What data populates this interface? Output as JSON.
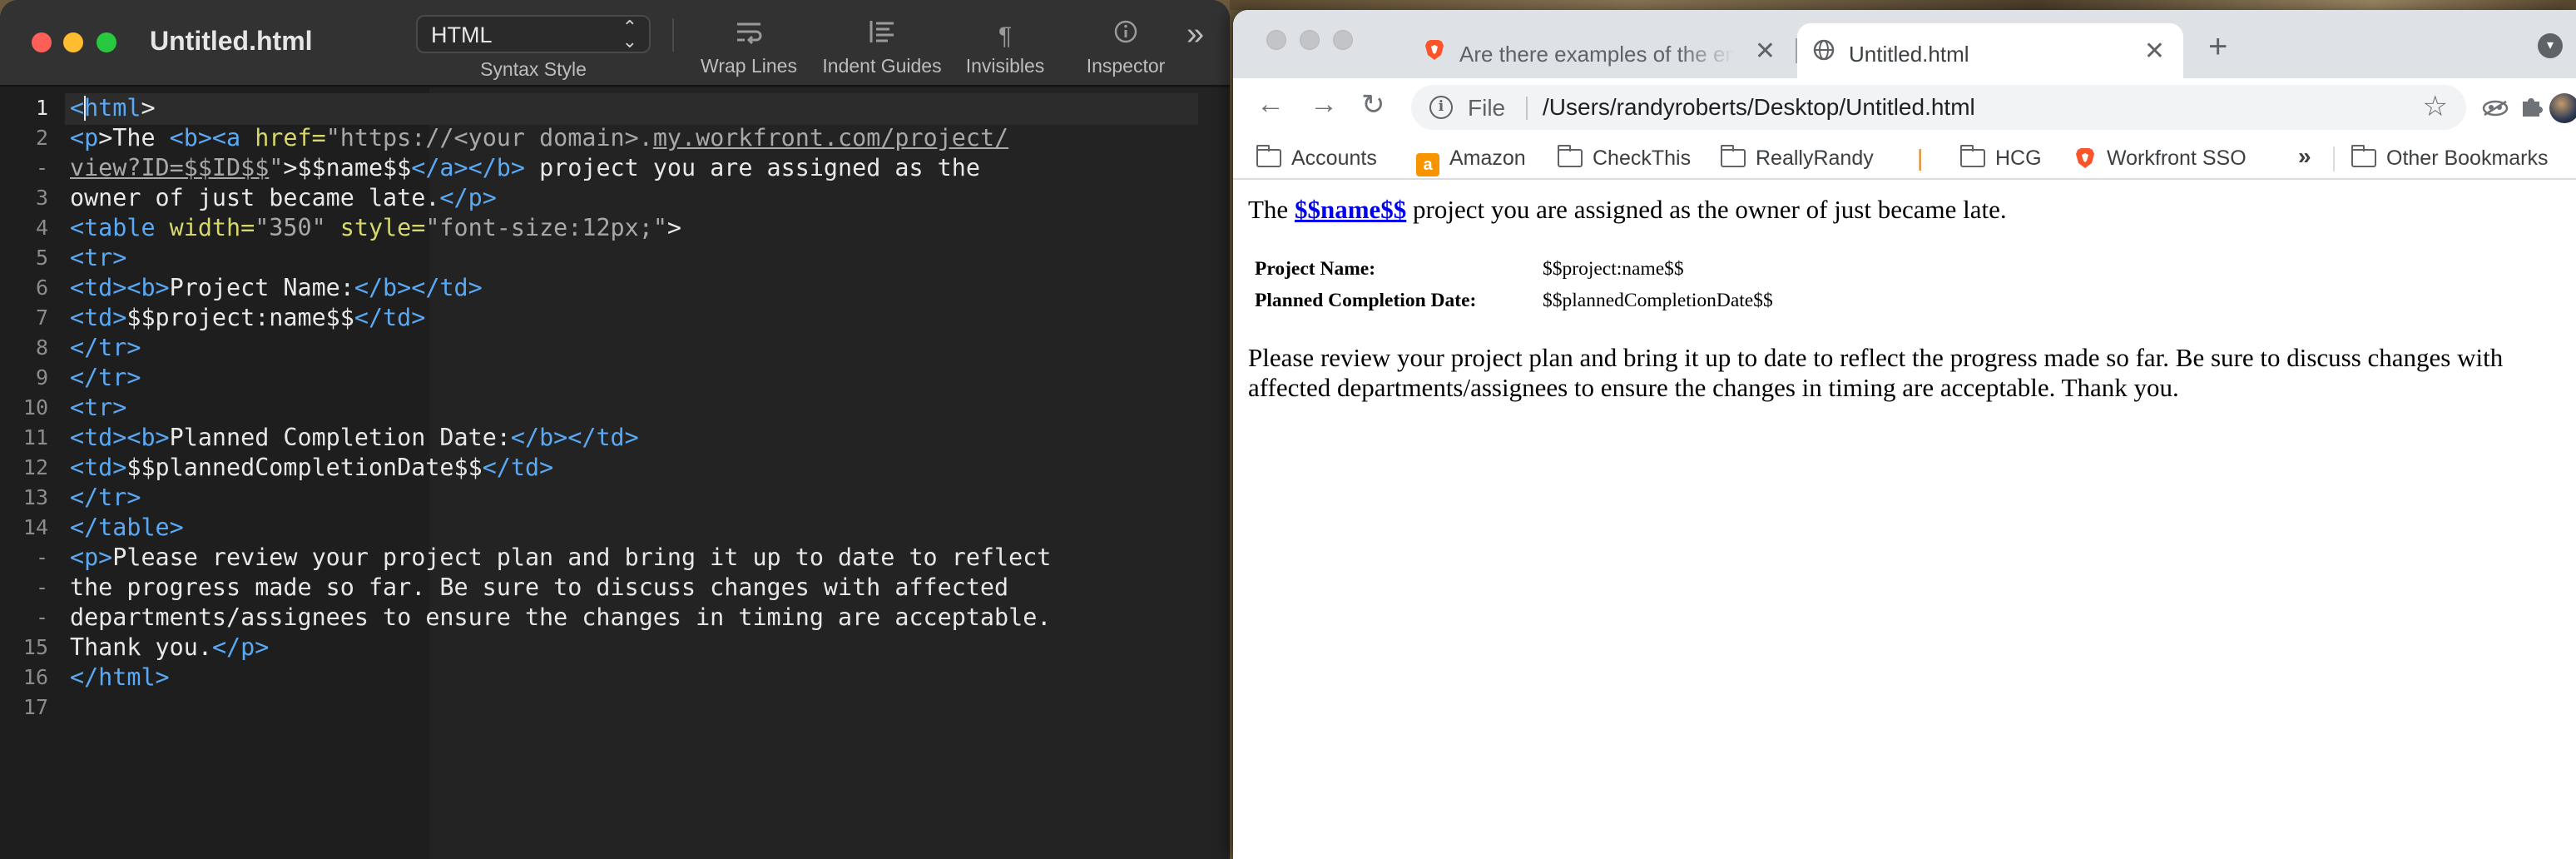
{
  "editor": {
    "title": "Untitled.html",
    "syntax_style": {
      "value": "HTML",
      "label": "Syntax Style"
    },
    "toolbar": {
      "wrap_lines": "Wrap Lines",
      "indent_guides": "Indent Guides",
      "invisibles": "Invisibles",
      "inspector": "Inspector"
    },
    "line_numbers": [
      "1",
      "2",
      "-",
      "3",
      "4",
      "5",
      "6",
      "7",
      "8",
      "9",
      "10",
      "11",
      "12",
      "13",
      "14",
      "-",
      "-",
      "-",
      "15",
      "16",
      "17"
    ],
    "active_line": "1",
    "code_lines": [
      [
        [
          "t",
          "<"
        ],
        [
          "c",
          ""
        ],
        [
          "t",
          "html"
        ],
        [
          "p",
          ">"
        ]
      ],
      [
        [
          "t",
          "<p"
        ],
        [
          "p",
          ">The "
        ],
        [
          "t",
          "<b><a "
        ],
        [
          "a",
          "href="
        ],
        [
          "s",
          "\"https://<your domain>."
        ],
        [
          "u",
          "my.workfront.com/project/"
        ]
      ],
      [
        [
          "u",
          "view?ID=$$ID$$"
        ],
        [
          "s",
          "\""
        ],
        [
          "p",
          ">$$name$$"
        ],
        [
          "t",
          "</a></b>"
        ],
        [
          "p",
          " project you are assigned as the"
        ]
      ],
      [
        [
          "p",
          "owner of just became late."
        ],
        [
          "t",
          "</p>"
        ]
      ],
      [
        [
          "t",
          "<table "
        ],
        [
          "a",
          "width="
        ],
        [
          "s",
          "\"350\" "
        ],
        [
          "a",
          "style="
        ],
        [
          "s",
          "\"font-size:12px;\""
        ],
        [
          "p",
          ">"
        ]
      ],
      [
        [
          "t",
          "<tr>"
        ]
      ],
      [
        [
          "t",
          "<td><b>"
        ],
        [
          "p",
          "Project Name:"
        ],
        [
          "t",
          "</b></td>"
        ]
      ],
      [
        [
          "t",
          "<td>"
        ],
        [
          "p",
          "$$project:name$$"
        ],
        [
          "t",
          "</td>"
        ]
      ],
      [
        [
          "t",
          "</tr>"
        ]
      ],
      [
        [
          "t",
          "</tr>"
        ]
      ],
      [
        [
          "t",
          "<tr>"
        ]
      ],
      [
        [
          "t",
          "<td><b>"
        ],
        [
          "p",
          "Planned Completion Date:"
        ],
        [
          "t",
          "</b></td>"
        ]
      ],
      [
        [
          "t",
          "<td>"
        ],
        [
          "p",
          "$$plannedCompletionDate$$"
        ],
        [
          "t",
          "</td>"
        ]
      ],
      [
        [
          "t",
          "</tr>"
        ]
      ],
      [
        [
          "t",
          "</table>"
        ]
      ],
      [
        [
          "t",
          "<p>"
        ],
        [
          "p",
          "Please review your project plan and bring it up to date to reflect"
        ]
      ],
      [
        [
          "p",
          "the progress made so far. Be sure to discuss changes with affected"
        ]
      ],
      [
        [
          "p",
          "departments/assignees to ensure the changes in timing are acceptable."
        ]
      ],
      [
        [
          "p",
          "Thank you."
        ],
        [
          "t",
          "</p>"
        ]
      ],
      [
        [
          "t",
          "</html>"
        ]
      ],
      []
    ]
  },
  "browser": {
    "tabs": [
      {
        "title": "Are there examples of the email",
        "favicon": "brave-lion-icon"
      },
      {
        "title": "Untitled.html",
        "favicon": "globe-icon"
      }
    ],
    "url_scheme": "File",
    "url_path": "/Users/randyroberts/Desktop/Untitled.html",
    "bookmarks": {
      "accounts": "Accounts",
      "amazon": "Amazon",
      "checkthis": "CheckThis",
      "reallyrandy": "ReallyRandy",
      "separator": "|",
      "hcg": "HCG",
      "workfront": "Workfront SSO",
      "more": "»",
      "other": "Other Bookmarks"
    },
    "page": {
      "intro_before": "The ",
      "intro_link": "$$name$$",
      "intro_after": " project you are assigned as the owner of just became late.",
      "table": [
        {
          "label": "Project Name:",
          "value": "$$project:name$$"
        },
        {
          "label": "Planned Completion Date:",
          "value": "$$plannedCompletionDate$$"
        }
      ],
      "review": "Please review your project plan and bring it up to date to reflect the progress made so far. Be sure to discuss changes with affected departments/assignees to ensure the changes in timing are acceptable. Thank you."
    }
  },
  "colors": {
    "tag": "#5aa9f5",
    "attribute": "#d7d76d",
    "string": "#a8a8a8",
    "link": "#0000ee",
    "close": "#fe5f57",
    "minimize": "#febc2e",
    "zoom": "#28c840"
  }
}
